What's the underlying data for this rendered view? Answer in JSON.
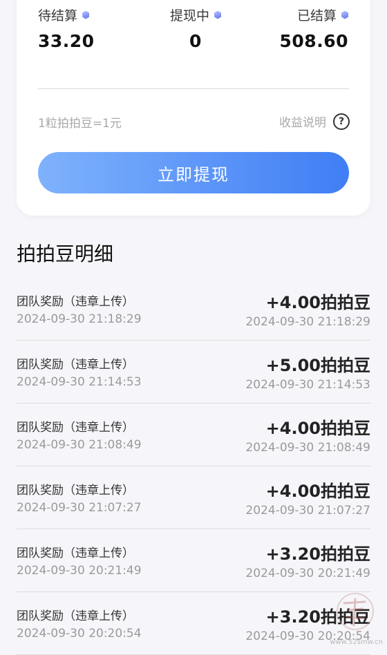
{
  "stats": [
    {
      "label": "待结算",
      "value": "33.20"
    },
    {
      "label": "提现中",
      "value": "0"
    },
    {
      "label": "已结算",
      "value": "508.60"
    }
  ],
  "rate_text": "1粒拍拍豆=1元",
  "explain_label": "收益说明",
  "withdraw_label": "立即提现",
  "section_title": "拍拍豆明细",
  "records": [
    {
      "title": "团队奖励（违章上传）",
      "date": "2024-09-30 21:18:29",
      "amount": "+4.00拍拍豆"
    },
    {
      "title": "团队奖励（违章上传）",
      "date": "2024-09-30 21:14:53",
      "amount": "+5.00拍拍豆"
    },
    {
      "title": "团队奖励（违章上传）",
      "date": "2024-09-30 21:08:49",
      "amount": "+4.00拍拍豆"
    },
    {
      "title": "团队奖励（违章上传）",
      "date": "2024-09-30 21:07:27",
      "amount": "+4.00拍拍豆"
    },
    {
      "title": "团队奖励（违章上传）",
      "date": "2024-09-30 20:21:49",
      "amount": "+3.20拍拍豆"
    },
    {
      "title": "团队奖励（违章上传）",
      "date": "2024-09-30 20:20:54",
      "amount": "+3.20拍拍豆"
    }
  ],
  "watermark_text": "www.52smw.cn",
  "colors": {
    "accent_start": "#7fb2fc",
    "accent_end": "#3f7ef5",
    "background": "#f6f6fa"
  },
  "icons": {
    "stat_marker": "gem-icon",
    "help": "question-circle-icon"
  }
}
